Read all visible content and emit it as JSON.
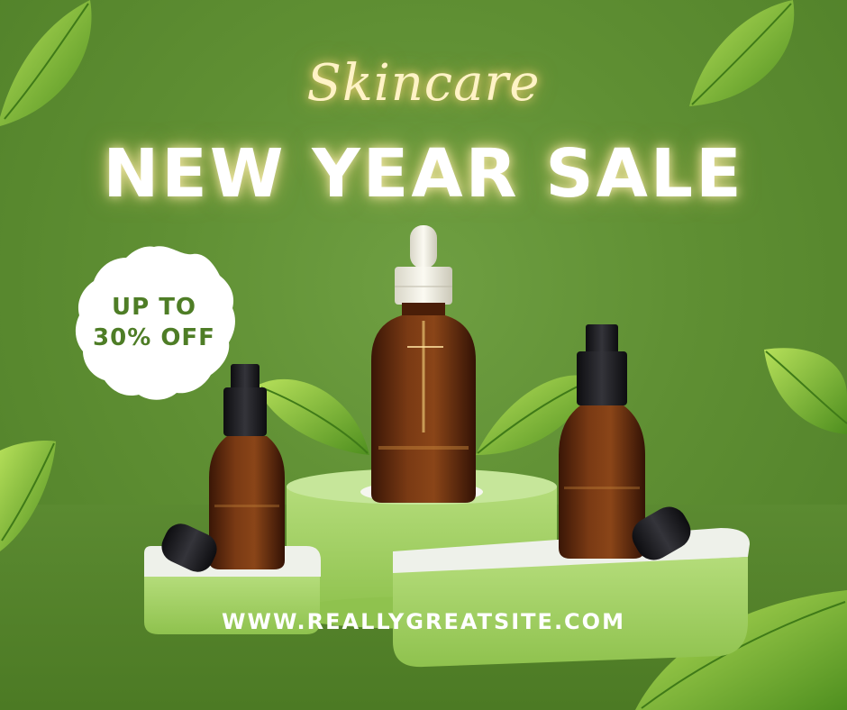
{
  "headline": {
    "script_line": "Skincare",
    "main_line": "NEW YEAR SALE"
  },
  "badge": {
    "line1": "UP TO",
    "line2": "30% OFF"
  },
  "website": "WWW.REALLYGREATSITE.COM",
  "colors": {
    "background": "#5f8f33",
    "podium": "#9ccc5a",
    "podium_top": "#e9eee4",
    "amber_glass": "#6b2e10",
    "glow": "#ffe8a0"
  },
  "products": [
    "dropper-bottle",
    "pump-bottle-left",
    "pump-bottle-right"
  ]
}
